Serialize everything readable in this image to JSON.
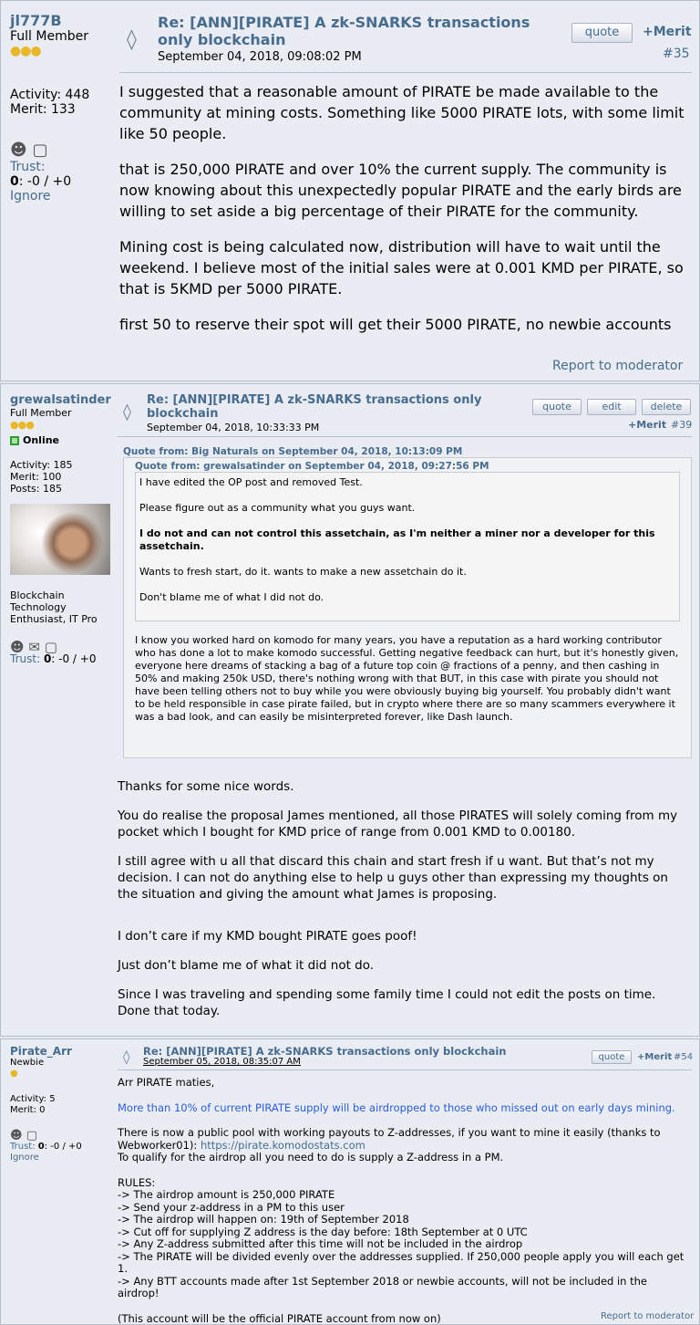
{
  "posts": [
    {
      "username": "jl777B",
      "rank": "Full Member",
      "activity": "Activity: 448",
      "merit": "Merit: 133",
      "trust_label": "Trust:",
      "trust_value": "0",
      "trust_rest": ": -0 / +0",
      "ignore": "Ignore",
      "subject_line1": "Re: [ANN][PIRATE] A zk-SNARKS transactions",
      "subject_line2": "only blockchain",
      "date": "September 04, 2018, 09:08:02 PM",
      "quote": "quote",
      "merit_btn": "+Merit",
      "post_num": "#35",
      "paragraphs": [
        "I suggested that a reasonable amount of PIRATE be made available to the community at mining costs. Something like 5000 PIRATE lots, with some limit like 50 people.",
        "that is 250,000 PIRATE and over 10% the current supply. The community is now knowing about this unexpectedly popular PIRATE and the early birds are willing to set aside a big percentage of their PIRATE for the community.",
        "Mining cost is being calculated now, distribution will have to wait until the weekend. I believe most of the initial sales were at 0.001 KMD per PIRATE, so that is 5KMD per 5000 PIRATE.",
        "first 50 to reserve their spot will get their 5000 PIRATE, no newbie accounts"
      ],
      "report": "Report to moderator"
    },
    {
      "username": "grewalsatinder",
      "rank": "Full Member",
      "online": "Online",
      "activity": "Activity: 185",
      "merit": "Merit: 100",
      "posts": "Posts: 185",
      "personal_text": [
        "Blockchain",
        "Technology",
        "Enthusiast, IT Pro"
      ],
      "trust_label": "Trust:",
      "trust_value": "0",
      "trust_rest": ": -0 / +0",
      "subject_line1": "Re: [ANN][PIRATE] A zk-SNARKS transactions only",
      "subject_line2": "blockchain",
      "date": "September 04, 2018, 10:33:33 PM",
      "quote": "quote",
      "edit": "edit",
      "delete": "delete",
      "merit_btn": "+Merit",
      "post_num": "#39",
      "outer_quote_header": "Quote from: Big Naturals on September 04, 2018, 10:13:09 PM",
      "inner_quote_header": "Quote from: grewalsatinder on September 04, 2018, 09:27:56 PM",
      "inner_quote": [
        "I have edited the OP post and removed Test.",
        "Please figure out as a community what you guys want.",
        "I do not and can not control this assetchain, as I'm neither a miner nor a developer for this assetchain.",
        "Wants to fresh start, do it. wants to make a new assetchain do it.",
        "Don't blame me of what I did not do."
      ],
      "outer_quote_text": "I know you worked hard on komodo for many years, you have a reputation as a hard working contributor who has done a lot to make komodo successful. Getting negative feedback can hurt, but it's honestly given, everyone here dreams of stacking a bag of a future top coin @ fractions of a penny, and then cashing in 50% and making 250k USD, there's nothing wrong with that BUT, in this case with pirate you should not have been telling others not to buy while you were obviously buying big yourself. You probably didn't want to be held responsible in case pirate failed, but in crypto where there are so many scammers everywhere it was a bad look, and can easily be misinterpreted forever, like Dash launch.",
      "paragraphs": [
        "Thanks for some nice words.",
        "You do realise the proposal James mentioned, all those PIRATES will solely coming from my pocket which I bought for KMD price of range from 0.001 KMD to 0.00180.",
        "I still agree with u all that discard this chain and start fresh if u want. But that’s not my decision. I can not do anything else to help u guys other than expressing my thoughts on the situation and giving the amount what James is proposing.",
        "I don’t care if my KMD bought PIRATE goes poof!",
        "Just don’t blame me of what it did not do.",
        "Since I was traveling and spending some family time I could not edit the posts on time. Done that today."
      ]
    },
    {
      "username": "Pirate_Arr",
      "rank": "Newbie",
      "activity": "Activity: 5",
      "merit": "Merit: 0",
      "trust_label": "Trust:",
      "trust_value": "0",
      "trust_rest": ": -0 / +0",
      "ignore": "Ignore",
      "subject": "Re: [ANN][PIRATE] A zk-SNARKS transactions only blockchain",
      "date": "September 05, 2018, 08:35:07 AM",
      "quote": "quote",
      "merit_btn": "+Merit",
      "post_num": "#54",
      "greeting": "Arr PIRATE maties,",
      "highlight": "More than 10% of current PIRATE supply will be airdropped to those who missed out on early days mining.",
      "pool_text": "There is now a public pool with working payouts to Z-addresses, if you want to mine it easily (thanks to Webworker01): ",
      "pool_link": "https://pirate.komodostats.com",
      "qualify": "To qualify for the airdrop all you need to do is supply a Z-address in a PM.",
      "rules_title": "RULES:",
      "rules": [
        "-> The airdrop amount is 250,000 PIRATE",
        "-> Send your z-address in a PM to this user",
        "-> The airdrop will happen on: 19th of September 2018",
        "-> Cut off for supplying Z address is the day before: 18th September at 0 UTC",
        "-> Any Z-address submitted after this time will not be included in the airdrop",
        "-> The PIRATE will be divided evenly over the addresses supplied. If 250,000 people apply you will each get 1.",
        "-> Any BTT accounts made after 1st September 2018 or newbie accounts, will not be included in the airdrop!"
      ],
      "closing": "(This account will be the official PIRATE account from now on)",
      "report": "Report to moderator"
    }
  ]
}
